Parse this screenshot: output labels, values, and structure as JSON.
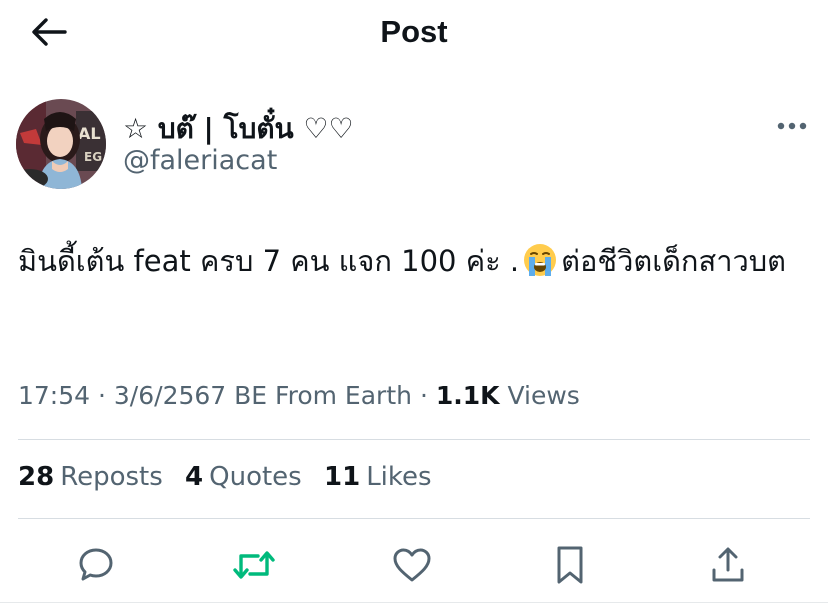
{
  "header": {
    "title": "Post",
    "back_icon": "arrow-left-icon"
  },
  "author": {
    "display_name": "☆ บต๊ | โบตั๋น ♡♡",
    "handle": "@faleriacat"
  },
  "tweet": {
    "text_before_emoji": "มินดี้เต้น feat ครบ 7 คน แจก 100 ค่ะ .",
    "emoji": "loudly-crying-face",
    "text_after_emoji": "ต่อชีวิตเด็กสาวบต"
  },
  "meta": {
    "time": "17:54",
    "sep1": "·",
    "date": "3/6/2567 BE",
    "source": "From Earth",
    "sep2": "·",
    "views_count": "1.1K",
    "views_label": "Views"
  },
  "stats": {
    "reposts_count": "28",
    "reposts_label": "Reposts",
    "quotes_count": "4",
    "quotes_label": "Quotes",
    "likes_count": "11",
    "likes_label": "Likes"
  },
  "actions": [
    {
      "name": "reply",
      "icon": "reply-icon"
    },
    {
      "name": "repost",
      "icon": "repost-icon",
      "color": "#00ba7c"
    },
    {
      "name": "like",
      "icon": "heart-icon"
    },
    {
      "name": "bookmark",
      "icon": "bookmark-icon"
    },
    {
      "name": "share",
      "icon": "share-icon"
    }
  ],
  "colors": {
    "text": "#0f1419",
    "secondary": "#536471",
    "icon": "#536471",
    "repost_green": "#00ba7c",
    "divider": "#d7dde2"
  }
}
